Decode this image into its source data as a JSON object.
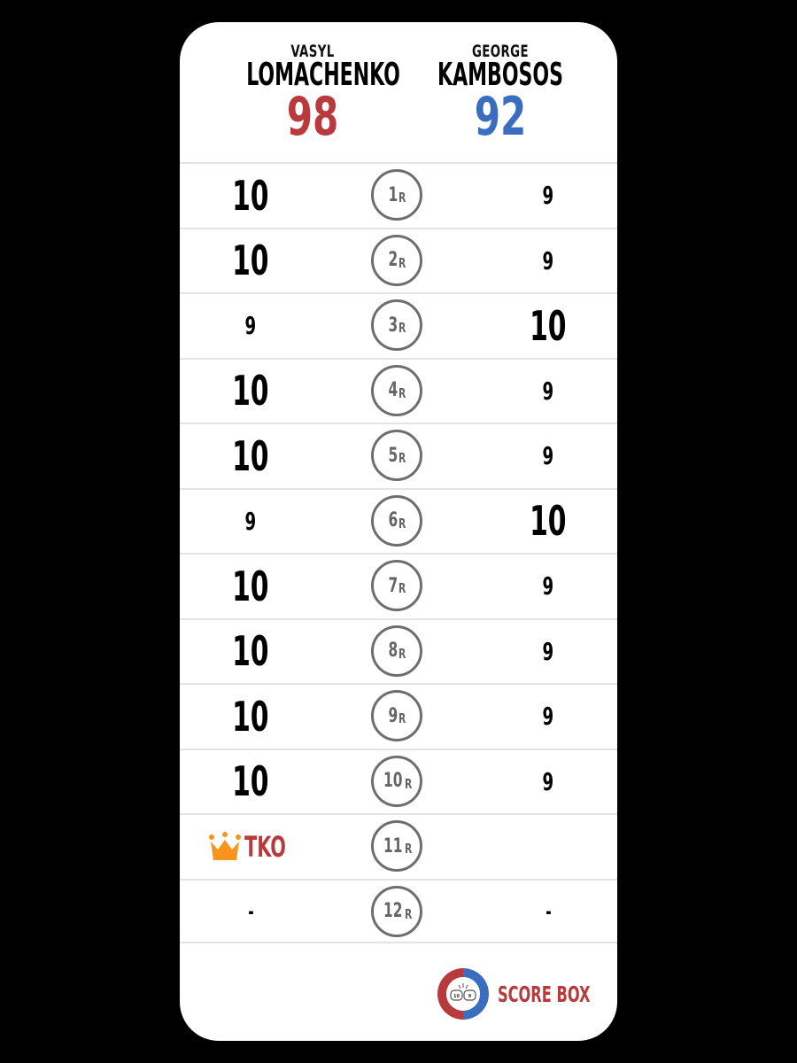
{
  "fighters": {
    "red": {
      "first_name": "VASYL",
      "last_name": "LOMACHENKO",
      "total": "98",
      "color": "#b83a3d"
    },
    "blue": {
      "first_name": "GEORGE",
      "last_name": "KAMBOSOS",
      "total": "92",
      "color": "#3a6cc0"
    }
  },
  "round_suffix": "R",
  "rounds": [
    {
      "round": "1",
      "red": "10",
      "blue": "9"
    },
    {
      "round": "2",
      "red": "10",
      "blue": "9"
    },
    {
      "round": "3",
      "red": "9",
      "blue": "10"
    },
    {
      "round": "4",
      "red": "10",
      "blue": "9"
    },
    {
      "round": "5",
      "red": "10",
      "blue": "9"
    },
    {
      "round": "6",
      "red": "9",
      "blue": "10"
    },
    {
      "round": "7",
      "red": "10",
      "blue": "9"
    },
    {
      "round": "8",
      "red": "10",
      "blue": "9"
    },
    {
      "round": "9",
      "red": "10",
      "blue": "9"
    },
    {
      "round": "10",
      "red": "10",
      "blue": "9"
    },
    {
      "round": "11",
      "red": "TKO",
      "blue": "",
      "red_winner_icon": "crown-icon"
    },
    {
      "round": "12",
      "red": "-",
      "blue": "-"
    }
  ],
  "brand": {
    "name": "SCORE BOX",
    "logo_icon": "boxing-gloves-icon",
    "logo_scores": [
      "10",
      "9"
    ]
  }
}
